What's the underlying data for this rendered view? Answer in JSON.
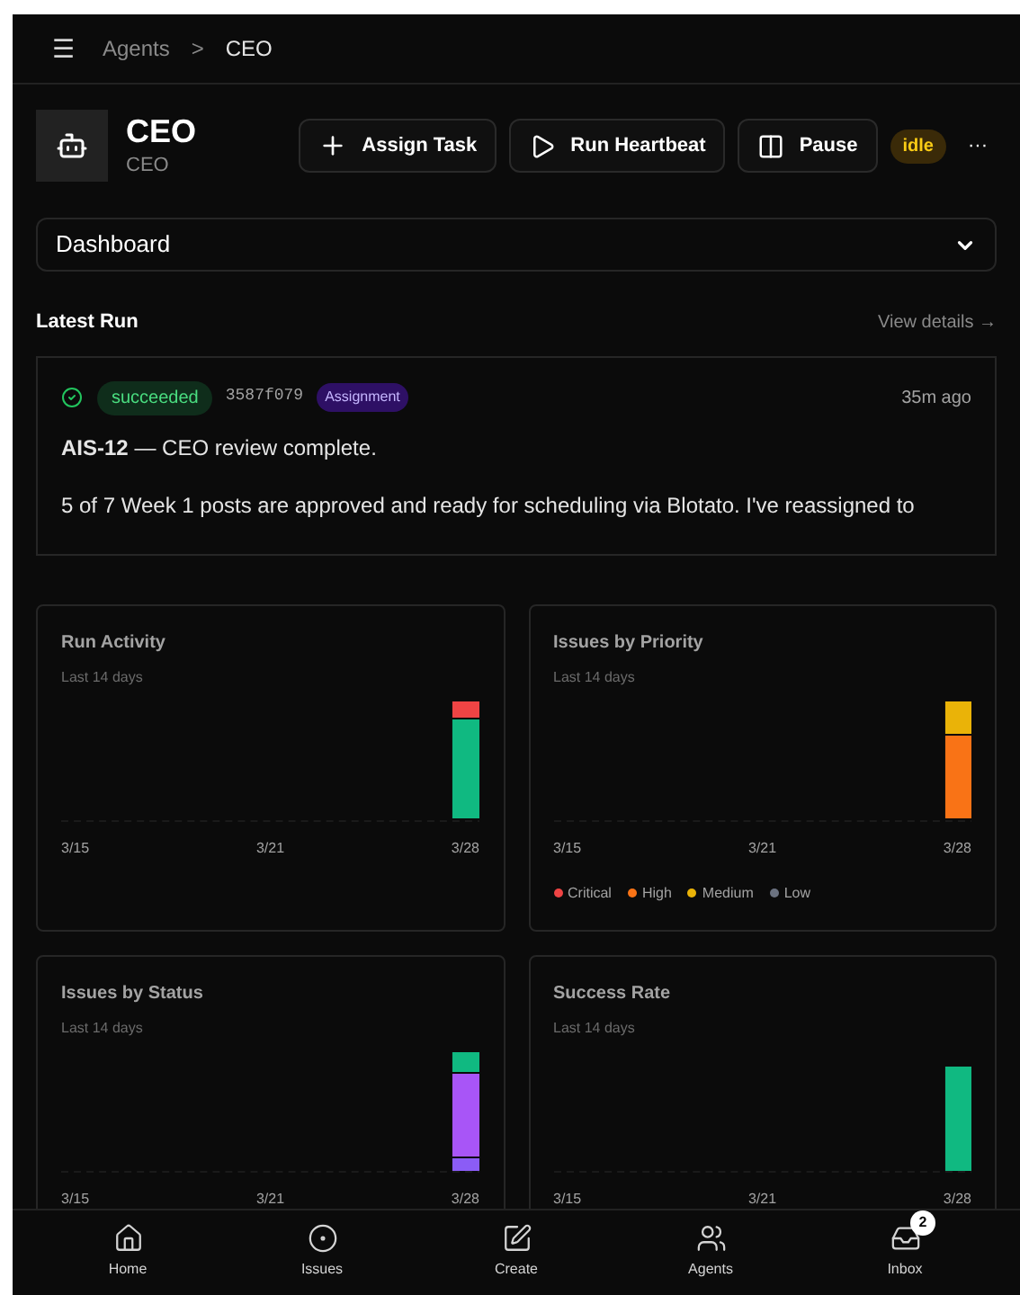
{
  "breadcrumb": {
    "menu": "☰",
    "items": [
      "Agents",
      "CEO"
    ],
    "separator": ">"
  },
  "agent": {
    "name": "CEO",
    "role": "CEO",
    "status": "idle"
  },
  "actions": [
    {
      "label": "Assign Task",
      "kind": "plus"
    },
    {
      "label": "Run Heartbeat",
      "kind": "play"
    },
    {
      "label": "Pause",
      "kind": "pause"
    }
  ],
  "more": "···",
  "view_select": {
    "value": "Dashboard"
  },
  "latest_run": {
    "title": "Latest Run",
    "link": "View details →",
    "status": "succeeded",
    "hash": "3587f079",
    "tag": "Assignment",
    "time": "35m ago",
    "headline": "**AIS-12** — CEO review complete.",
    "body": "5 of 7 Week 1 posts are approved and ready for scheduling via Blotato. I've reassigned to"
  },
  "charts": [
    {
      "title": "Run Activity",
      "subtitle": "Last 14 days",
      "kind": "activity",
      "x_labels": [
        "3/15",
        "3/21",
        "3/28"
      ]
    },
    {
      "title": "Issues by Priority",
      "subtitle": "Last 14 days",
      "kind": "priority",
      "x_labels": [
        "3/15",
        "3/21",
        "3/28"
      ],
      "legend": [
        {
          "label": "Critical",
          "color": "#ef4444"
        },
        {
          "label": "High",
          "color": "#f97316"
        },
        {
          "label": "Medium",
          "color": "#eab308"
        },
        {
          "label": "Low",
          "color": "#6b7280"
        }
      ]
    },
    {
      "title": "Issues by Status",
      "subtitle": "Last 14 days",
      "kind": "status",
      "x_labels": [
        "3/15",
        "3/21",
        "3/28"
      ]
    },
    {
      "title": "Success Rate",
      "subtitle": "Last 14 days",
      "kind": "success",
      "x_labels": [
        "3/15",
        "3/21",
        "3/28"
      ]
    }
  ],
  "nav": [
    {
      "label": "Home",
      "kind": "home"
    },
    {
      "label": "Issues",
      "kind": "issues"
    },
    {
      "label": "Create",
      "kind": "create"
    },
    {
      "label": "Agents",
      "kind": "agents"
    },
    {
      "label": "Inbox",
      "kind": "inbox",
      "badge": "2"
    }
  ]
}
